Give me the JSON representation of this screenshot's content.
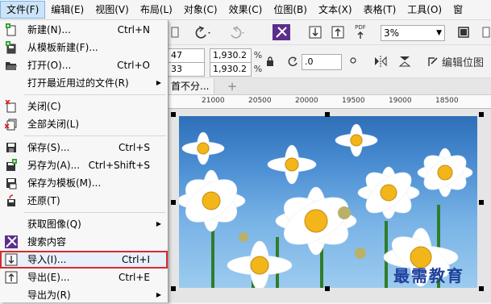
{
  "menubar": {
    "items": [
      {
        "label": "文件(F)"
      },
      {
        "label": "编辑(E)"
      },
      {
        "label": "视图(V)"
      },
      {
        "label": "布局(L)"
      },
      {
        "label": "对象(C)"
      },
      {
        "label": "效果(C)"
      },
      {
        "label": "位图(B)"
      },
      {
        "label": "文本(X)"
      },
      {
        "label": "表格(T)"
      },
      {
        "label": "工具(O)"
      },
      {
        "label": "窗"
      }
    ]
  },
  "file_menu": {
    "items": [
      {
        "label": "新建(N)...",
        "shortcut": "Ctrl+N",
        "icon": "new-document-icon"
      },
      {
        "label": "从模板新建(F)...",
        "shortcut": "",
        "icon": "new-from-template-icon"
      },
      {
        "label": "打开(O)...",
        "shortcut": "Ctrl+O",
        "icon": "open-folder-icon"
      },
      {
        "label": "打开最近用过的文件(R)",
        "shortcut": "",
        "icon": ""
      },
      {
        "label": "关闭(C)",
        "shortcut": "",
        "icon": "close-document-icon"
      },
      {
        "label": "全部关闭(L)",
        "shortcut": "",
        "icon": "close-all-icon"
      },
      {
        "label": "保存(S)...",
        "shortcut": "Ctrl+S",
        "icon": "save-icon"
      },
      {
        "label": "另存为(A)...",
        "shortcut": "Ctrl+Shift+S",
        "icon": "save-as-icon"
      },
      {
        "label": "保存为模板(M)...",
        "shortcut": "",
        "icon": "save-template-icon"
      },
      {
        "label": "还原(T)",
        "shortcut": "",
        "icon": "revert-icon"
      },
      {
        "label": "获取图像(Q)",
        "shortcut": "",
        "icon": ""
      },
      {
        "label": "搜索内容",
        "shortcut": "",
        "icon": "search-content-icon"
      },
      {
        "label": "导入(I)...",
        "shortcut": "Ctrl+I",
        "icon": "import-icon"
      },
      {
        "label": "导出(E)...",
        "shortcut": "Ctrl+E",
        "icon": "export-icon"
      },
      {
        "label": "导出为(R)",
        "shortcut": "",
        "icon": ""
      }
    ]
  },
  "toolbar": {
    "zoom_value": "3%",
    "pdf_label": "PDF",
    "edit_bitmap_label": "编辑位图"
  },
  "property_bar": {
    "width_value": "47 mm",
    "height_value": "33 mm",
    "scale_x": "1,930.2",
    "scale_y": "1,930.2",
    "unit": "%",
    "rotation": ".0"
  },
  "document_tab": {
    "label": "首不分...",
    "add_label": "+"
  },
  "ruler": {
    "ticks": [
      "21000",
      "20500",
      "20000",
      "19500",
      "19000",
      "18500"
    ]
  },
  "watermark": "最需教育"
}
